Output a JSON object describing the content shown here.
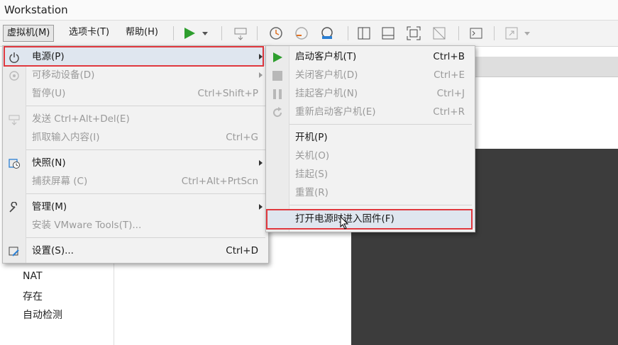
{
  "window": {
    "title": "Workstation"
  },
  "menubar": {
    "vm": "虚拟机(M)",
    "tabs": "选项卡(T)",
    "help": "帮助(H)"
  },
  "left_tree": [
    "NAT",
    "存在",
    "自动检测"
  ],
  "vm_menu": {
    "items": [
      {
        "label": "电源(P)",
        "shortcut": "",
        "icon": "power-icon",
        "submenu": true,
        "disabled": false,
        "highlighted": true
      },
      {
        "label": "可移动设备(D)",
        "shortcut": "",
        "icon": "removable-device-icon",
        "submenu": true,
        "disabled": true
      },
      {
        "label": "暂停(U)",
        "shortcut": "Ctrl+Shift+P",
        "icon": "",
        "submenu": false,
        "disabled": true
      },
      {
        "label": "发送 Ctrl+Alt+Del(E)",
        "shortcut": "",
        "icon": "send-keys-icon",
        "submenu": false,
        "disabled": true
      },
      {
        "label": "抓取输入内容(I)",
        "shortcut": "Ctrl+G",
        "icon": "",
        "submenu": false,
        "disabled": true
      },
      {
        "label": "快照(N)",
        "shortcut": "",
        "icon": "snapshot-icon",
        "submenu": true,
        "disabled": false
      },
      {
        "label": "捕获屏幕 (C)",
        "shortcut": "Ctrl+Alt+PrtScn",
        "icon": "",
        "submenu": false,
        "disabled": true
      },
      {
        "label": "管理(M)",
        "shortcut": "",
        "icon": "wrench-icon",
        "submenu": true,
        "disabled": false
      },
      {
        "label": "安装 VMware Tools(T)...",
        "shortcut": "",
        "icon": "",
        "submenu": false,
        "disabled": true
      },
      {
        "label": "设置(S)...",
        "shortcut": "Ctrl+D",
        "icon": "settings-icon",
        "submenu": false,
        "disabled": false
      }
    ]
  },
  "power_menu": {
    "items": [
      {
        "label": "启动客户机(T)",
        "shortcut": "Ctrl+B",
        "icon": "play-icon",
        "disabled": false
      },
      {
        "label": "关闭客户机(D)",
        "shortcut": "Ctrl+E",
        "icon": "stop-icon",
        "disabled": true
      },
      {
        "label": "挂起客户机(N)",
        "shortcut": "Ctrl+J",
        "icon": "pause-icon",
        "disabled": true
      },
      {
        "label": "重新启动客户机(E)",
        "shortcut": "Ctrl+R",
        "icon": "restart-icon",
        "disabled": true
      },
      {
        "label": "开机(P)",
        "shortcut": "",
        "icon": "",
        "disabled": false
      },
      {
        "label": "关机(O)",
        "shortcut": "",
        "icon": "",
        "disabled": true
      },
      {
        "label": "挂起(S)",
        "shortcut": "",
        "icon": "",
        "disabled": true
      },
      {
        "label": "重置(R)",
        "shortcut": "",
        "icon": "",
        "disabled": true
      },
      {
        "label": "打开电源时进入固件(F)",
        "shortcut": "",
        "icon": "",
        "disabled": false,
        "highlighted": true
      }
    ]
  },
  "colors": {
    "highlight_box": "#e0383e",
    "play_green": "#2e9e2e"
  }
}
